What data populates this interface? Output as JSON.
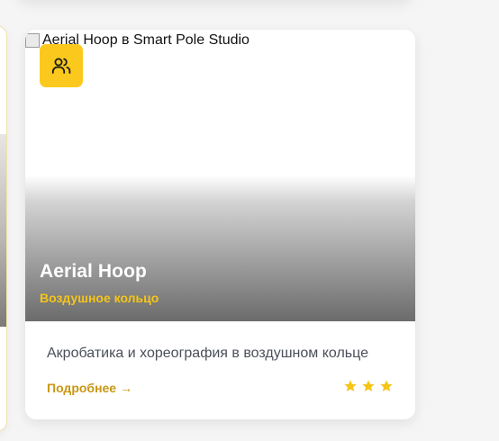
{
  "card": {
    "image_alt": "Aerial Hoop в Smart Pole Studio",
    "badge_icon": "users-icon",
    "title": "Aerial Hoop",
    "subtitle": "Воздушное кольцо",
    "description": "Акробатика и хореография в воздушном кольце",
    "more_link": "Подробнее →",
    "rating": 3,
    "rating_max": 3
  },
  "colors": {
    "accent": "#fbc91d",
    "subtitle": "#f5c518",
    "link": "#c99714",
    "star": "#f5c518",
    "text": "#4a4f59"
  }
}
